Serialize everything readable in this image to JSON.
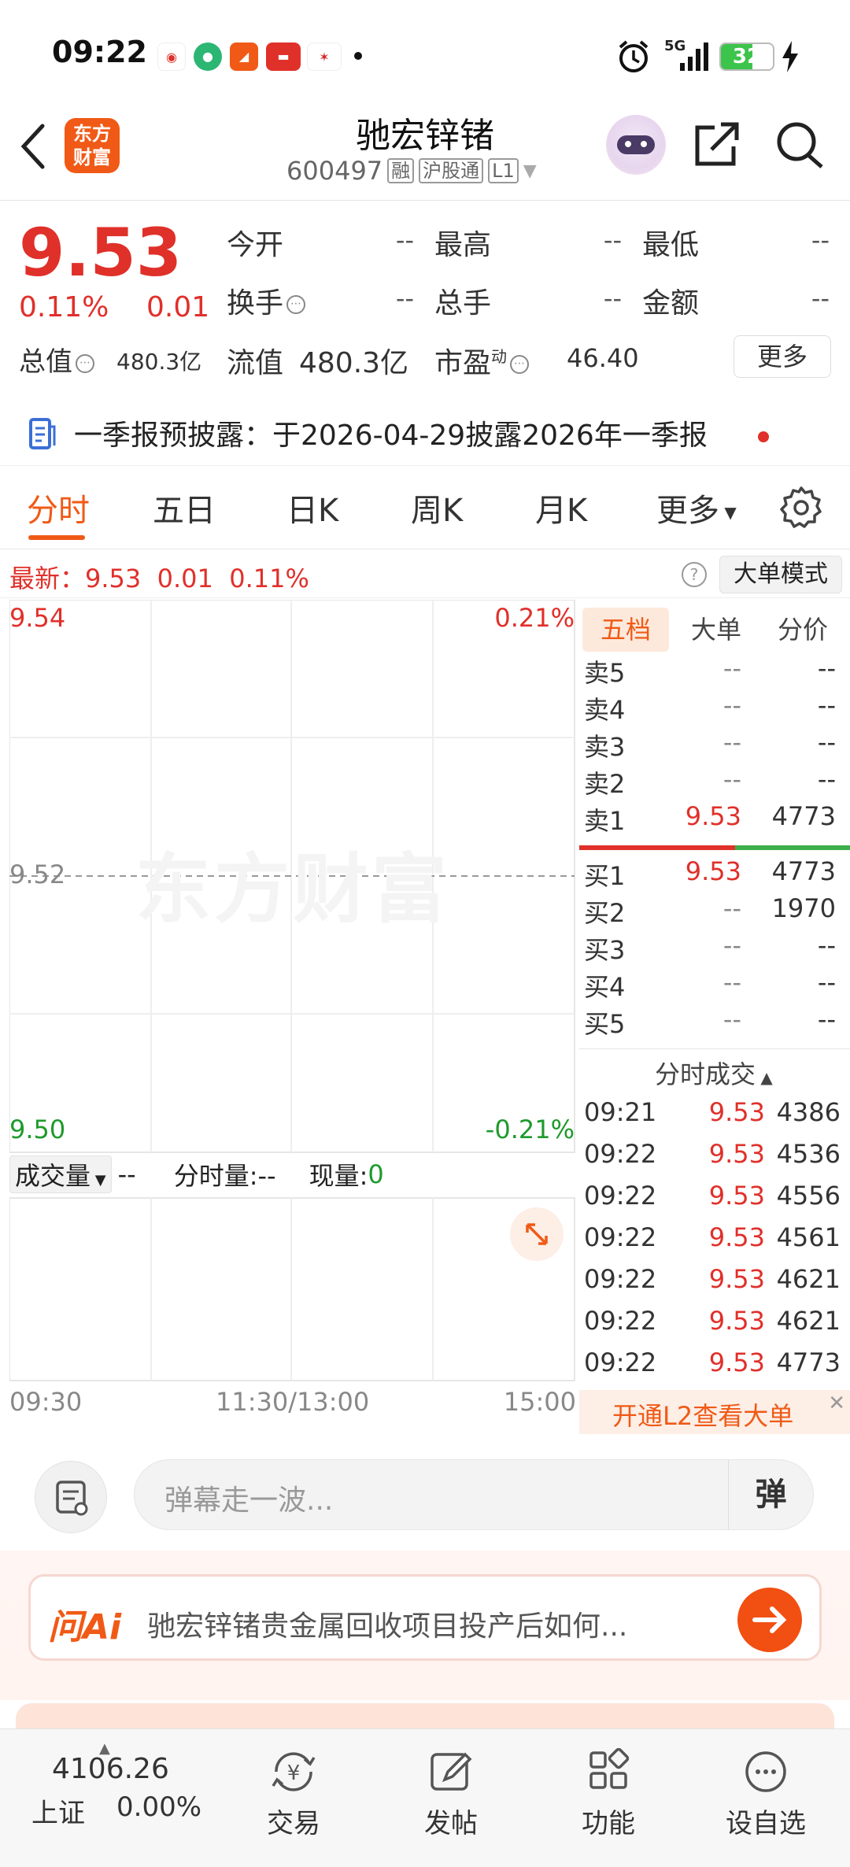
{
  "status_bar": {
    "time": "09:22",
    "battery": "32",
    "network": "5G"
  },
  "header": {
    "logo_text": "东方财富",
    "stock_name": "驰宏锌锗",
    "stock_code": "600497",
    "tags": [
      "融",
      "沪股通",
      "L1"
    ]
  },
  "quote": {
    "price": "9.53",
    "change_pct": "0.11%",
    "change_amt": "0.01",
    "rows": [
      [
        {
          "label": "今开",
          "value": "--"
        },
        {
          "label": "最高",
          "value": "--"
        },
        {
          "label": "最低",
          "value": "--"
        }
      ],
      [
        {
          "label": "换手",
          "value": "--"
        },
        {
          "label": "总手",
          "value": "--"
        },
        {
          "label": "金额",
          "value": "--"
        }
      ]
    ],
    "total_value_label": "总值",
    "total_value": "480.3亿",
    "float_value_label": "流值",
    "float_value": "480.3亿",
    "pe_label": "市盈",
    "pe_sup": "动",
    "pe_value": "46.40",
    "more_button": "更多"
  },
  "notice": {
    "text": "一季报预披露：于2026-04-29披露2026年一季报"
  },
  "tabs": {
    "items": [
      "分时",
      "五日",
      "日K",
      "周K",
      "月K",
      "更多"
    ],
    "active": 0
  },
  "latest": {
    "label": "最新：",
    "price": "9.53",
    "change": "0.01",
    "pct": "0.11%",
    "big_order_button": "大单模式"
  },
  "chart": {
    "watermark": "东方财富",
    "y_max": "9.54",
    "y_mid": "9.52",
    "y_min": "9.50",
    "pct_max": "0.21%",
    "pct_min": "-0.21%",
    "volume_selector": "成交量",
    "volume_value": "--",
    "intraday_volume": "分时量:--",
    "current_volume_label": "现量:",
    "current_volume": "0",
    "x_start": "09:30",
    "x_mid": "11:30/13:00",
    "x_end": "15:00"
  },
  "order_book": {
    "tabs": [
      "五档",
      "大单",
      "分价"
    ],
    "asks": [
      {
        "label": "卖5",
        "price": "--",
        "vol": "--"
      },
      {
        "label": "卖4",
        "price": "--",
        "vol": "--"
      },
      {
        "label": "卖3",
        "price": "--",
        "vol": "--"
      },
      {
        "label": "卖2",
        "price": "--",
        "vol": "--"
      },
      {
        "label": "卖1",
        "price": "9.53",
        "vol": "4773"
      }
    ],
    "bids": [
      {
        "label": "买1",
        "price": "9.53",
        "vol": "4773"
      },
      {
        "label": "买2",
        "price": "--",
        "vol": "1970"
      },
      {
        "label": "买3",
        "price": "--",
        "vol": "--"
      },
      {
        "label": "买4",
        "price": "--",
        "vol": "--"
      },
      {
        "label": "买5",
        "price": "--",
        "vol": "--"
      }
    ],
    "ticks_title": "分时成交",
    "ticks": [
      {
        "time": "09:21",
        "price": "9.53",
        "vol": "4386"
      },
      {
        "time": "09:22",
        "price": "9.53",
        "vol": "4536"
      },
      {
        "time": "09:22",
        "price": "9.53",
        "vol": "4556"
      },
      {
        "time": "09:22",
        "price": "9.53",
        "vol": "4561"
      },
      {
        "time": "09:22",
        "price": "9.53",
        "vol": "4621"
      },
      {
        "time": "09:22",
        "price": "9.53",
        "vol": "4621"
      },
      {
        "time": "09:22",
        "price": "9.53",
        "vol": "4773"
      }
    ],
    "l2_banner": "开通L2查看大单"
  },
  "comment": {
    "placeholder": "弹幕走一波...",
    "danmu_label": "弹"
  },
  "ai": {
    "logo": "问Ai",
    "question": "驰宏锌锗贵金属回收项目投产后如何..."
  },
  "bottom_nav": {
    "index_value": "4106.26",
    "index_name": "上证",
    "index_change": "0.00%",
    "items": [
      "交易",
      "发帖",
      "功能",
      "设自选"
    ]
  },
  "colors": {
    "up": "#e0302a",
    "down": "#1e9a2c",
    "accent": "#f05a16"
  }
}
